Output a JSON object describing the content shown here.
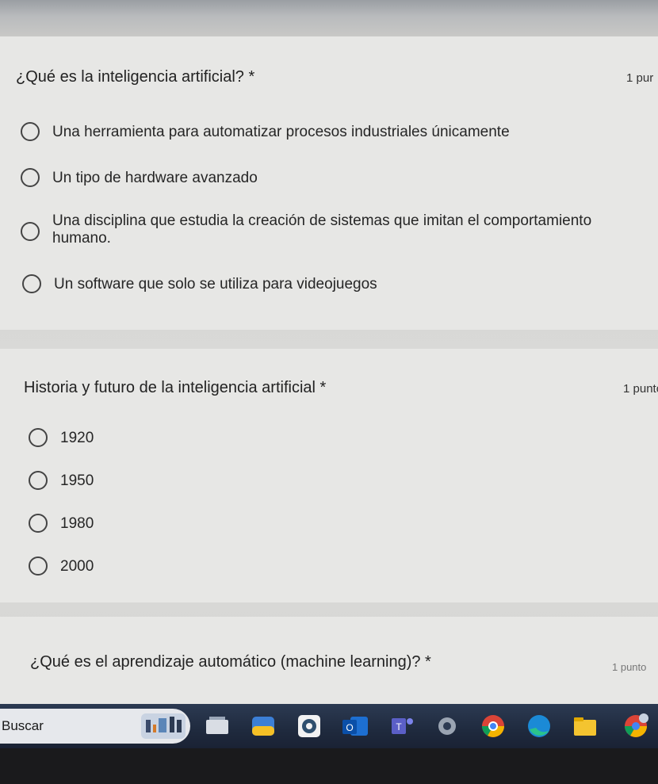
{
  "questions": [
    {
      "title": "¿Qué es la inteligencia artificial? *",
      "points": "1 pur",
      "options": [
        "Una herramienta para automatizar procesos industriales únicamente",
        "Un tipo de hardware avanzado",
        "Una disciplina que estudia la creación de sistemas que imitan el comportamiento humano.",
        "Un software que solo se utiliza para videojuegos"
      ]
    },
    {
      "title": "Historia y futuro de la inteligencia artificial *",
      "points": "1 punto",
      "options": [
        "1920",
        "1950",
        "1980",
        "2000"
      ]
    },
    {
      "title": "¿Qué es el aprendizaje automático (machine learning)? *",
      "points": "1 punto",
      "options": []
    }
  ],
  "taskbar": {
    "search_label": "Buscar",
    "icons": [
      "search-highlight-icon",
      "task-view-icon",
      "widgets-icon",
      "browser-icon",
      "outlook-icon",
      "teams-icon",
      "settings-icon",
      "chrome-icon",
      "edge-icon",
      "file-explorer-icon",
      "chrome-profile-icon"
    ]
  },
  "colors": {
    "card_bg": "#e7e7e5",
    "taskbar_bg": "#1f2a3e",
    "radio_border": "#444444"
  }
}
